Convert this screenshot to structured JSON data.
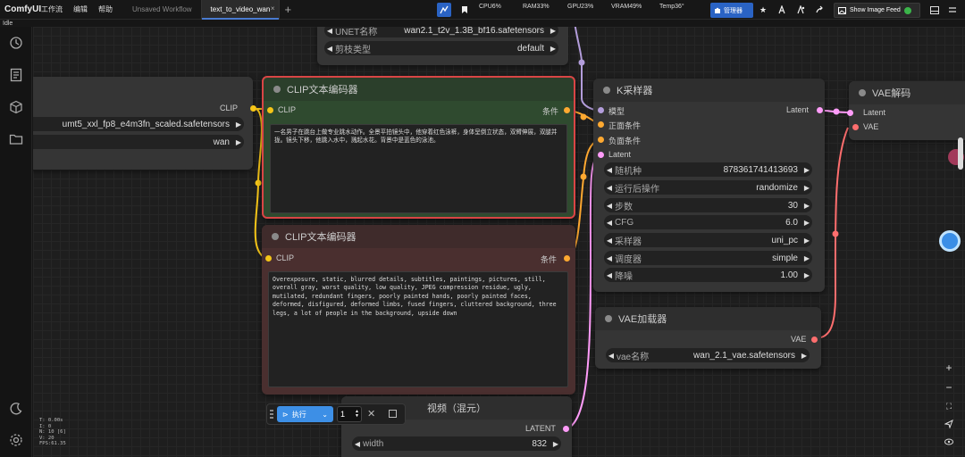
{
  "app": {
    "title": "ComfyUI",
    "status": "Idle"
  },
  "menu": [
    "工作流",
    "编辑",
    "帮助"
  ],
  "tabs": [
    {
      "label": "Unsaved Workflow"
    },
    {
      "label": "text_to_video_wan",
      "close": "×"
    }
  ],
  "tab_add": "+",
  "stats": {
    "cpu": "CPU6%",
    "ram": "RAM33%",
    "gpu": "GPU23%",
    "vram": "VRAM49%",
    "temp": "Temp36°"
  },
  "toolbar": {
    "manager_label": "管理器",
    "feed_label": "Show Image Feed"
  },
  "nodes": {
    "unet": {
      "widgets": [
        {
          "label": "UNET名称",
          "value": "wan2.1_t2v_1.3B_bf16.safetensors"
        },
        {
          "label": "剪枝类型",
          "value": "default"
        }
      ]
    },
    "clip_loader": {
      "title": "器",
      "output": "CLIP",
      "widgets": [
        {
          "value": "umt5_xxl_fp8_e4m3fn_scaled.safetensors"
        },
        {
          "value": "wan"
        }
      ]
    },
    "clip_pos": {
      "title": "CLIP文本编码器",
      "input": "CLIP",
      "output": "条件",
      "text": "一名男子在跳台上做专业跳水动作。全景平拍镜头中，他穿着红色泳裤，身体呈倒立状态，双臂伸展，双腿并拢。镜头下移，他跳入水中，溅起水花。背景中是蓝色的泳池。"
    },
    "clip_neg": {
      "title": "CLIP文本编码器",
      "input": "CLIP",
      "output": "条件",
      "text": "Overexposure, static, blurred details, subtitles, paintings, pictures, still, overall gray, worst quality, low quality, JPEG compression residue, ugly, mutilated, redundant fingers, poorly painted hands, poorly painted faces, deformed, disfigured, deformed limbs, fused fingers, cluttered background, three legs, a lot of people in the background, upside down"
    },
    "ksampler": {
      "title": "K采样器",
      "inputs": [
        "模型",
        "正面条件",
        "负面条件",
        "Latent"
      ],
      "output": "Latent",
      "widgets": [
        {
          "label": "随机种",
          "value": "878361741413693"
        },
        {
          "label": "运行后操作",
          "value": "randomize"
        },
        {
          "label": "步数",
          "value": "30"
        },
        {
          "label": "CFG",
          "value": "6.0"
        },
        {
          "label": "采样器",
          "value": "uni_pc"
        },
        {
          "label": "调度器",
          "value": "simple"
        },
        {
          "label": "降噪",
          "value": "1.00"
        }
      ]
    },
    "vae_decode": {
      "title": "VAE解码",
      "inputs": [
        "Latent",
        "VAE"
      ]
    },
    "vae_loader": {
      "title": "VAE加载器",
      "output": "VAE",
      "widget": {
        "label": "vae名称",
        "value": "wan_2.1_vae.safetensors"
      }
    },
    "latent_video": {
      "title": "视频（混元）",
      "output": "LATENT",
      "widget": {
        "label": "width",
        "value": "832"
      }
    }
  },
  "run_bar": {
    "label": "执行",
    "count": "1"
  },
  "perf": [
    "T: 0.00s",
    "I: 0",
    "N: 10 [6]",
    "V: 20",
    "FPS:61.35"
  ],
  "colors": {
    "clip": "#f5c518",
    "conditioning": "#ffa931",
    "model": "#b39ddb",
    "latent": "#ff9cf9",
    "vae": "#ff6e6e",
    "accent": "#2a63c4",
    "positive_node": "#2b4a2b",
    "negative_node": "#4a2b2b"
  }
}
